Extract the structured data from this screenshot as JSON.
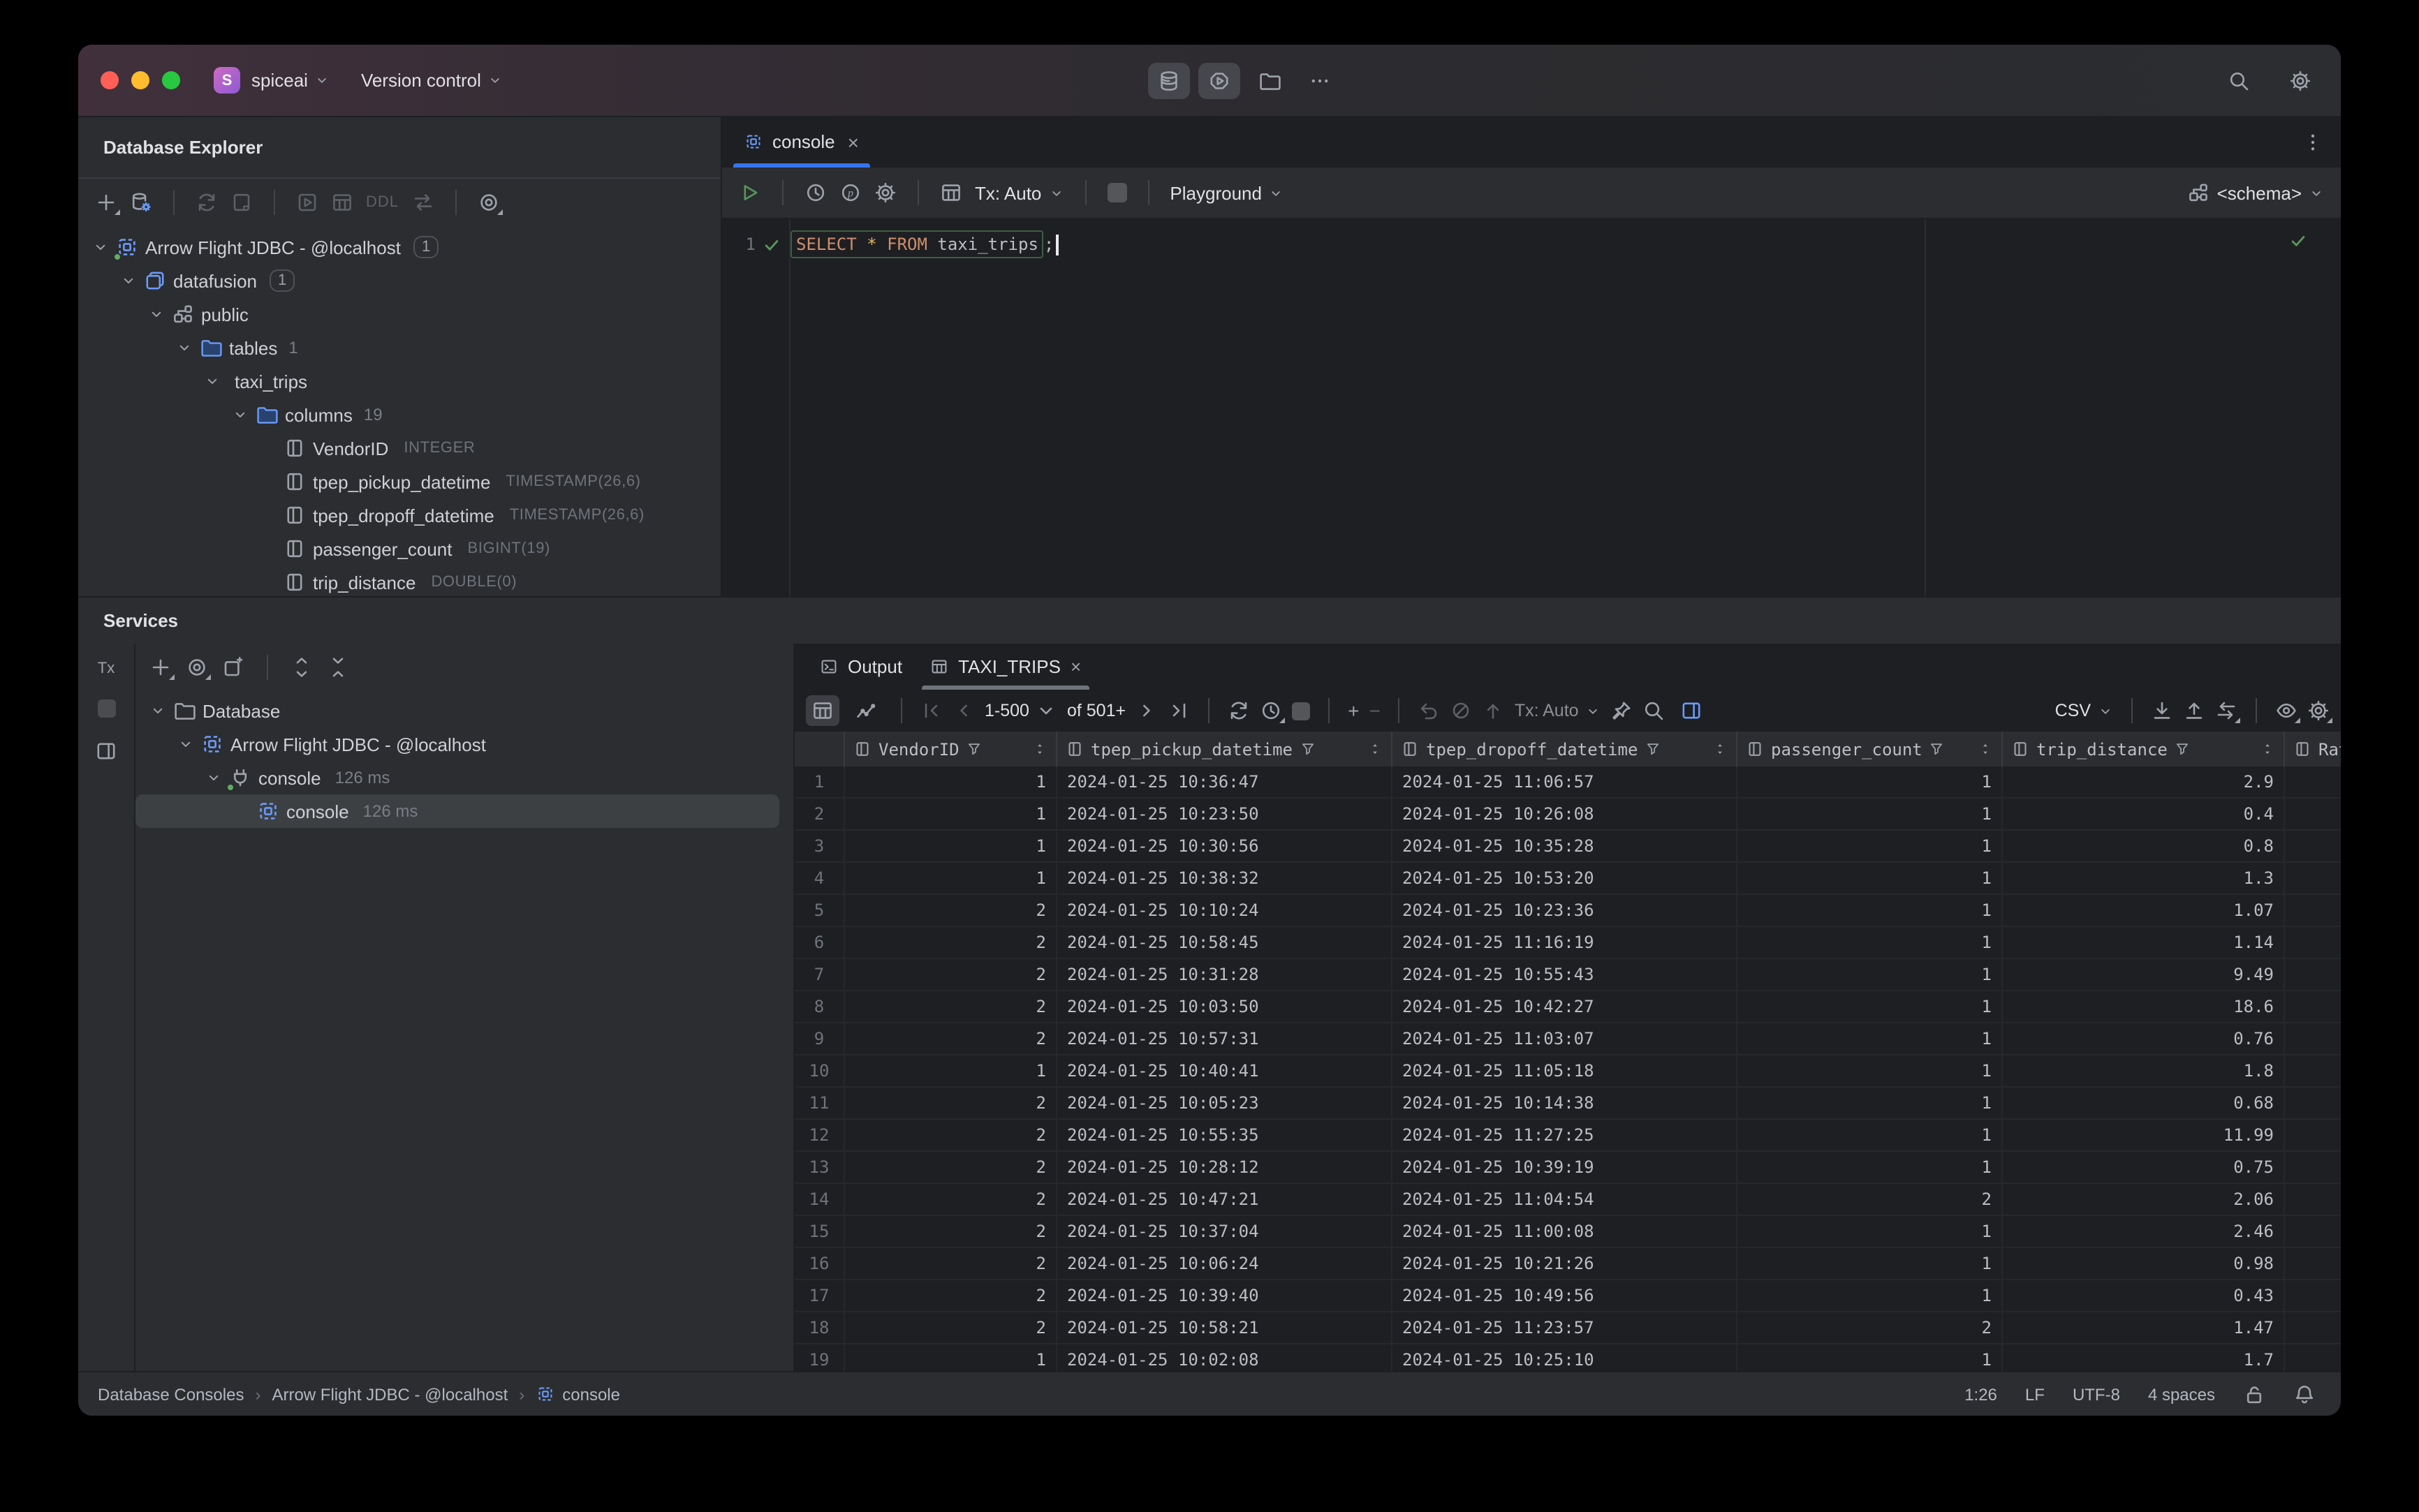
{
  "colors": {
    "accent_blue": "#3574f0",
    "icon_blue": "#6a9bfa",
    "green": "#57965c",
    "keyword_orange": "#cf8e6d",
    "star_yellow": "#e0b465",
    "window_bg": "#2b2d30",
    "editor_bg": "#1e1f22",
    "selection_bg": "#3d4043",
    "titlebar_tint": "#41303c"
  },
  "title_bar": {
    "app_badge": "S",
    "app_name": "spiceai",
    "menu_label": "Version control",
    "icons": [
      "database-icon",
      "hexagon-play-icon",
      "folder-icon",
      "more-icon",
      "search-icon",
      "settings-icon"
    ]
  },
  "database_explorer": {
    "title": "Database Explorer",
    "toolbar_icons": [
      "add-icon",
      "datasource-properties-icon",
      "refresh-icon",
      "jump-to-console-icon",
      "run-icon",
      "table-icon",
      "ddl-label",
      "compare-icon",
      "visibility-icon"
    ],
    "ddl_label": "DDL",
    "tree": [
      {
        "indent": 0,
        "icon": "datasource",
        "label": "Arrow Flight JDBC - @localhost",
        "badge": "1",
        "green_dot": true
      },
      {
        "indent": 1,
        "icon": "database",
        "label": "datafusion",
        "badge": "1"
      },
      {
        "indent": 2,
        "icon": "schema",
        "label": "public"
      },
      {
        "indent": 3,
        "icon": "folder",
        "label": "tables",
        "count": "1"
      },
      {
        "indent": 4,
        "icon": "table",
        "label": "taxi_trips"
      },
      {
        "indent": 5,
        "icon": "folder",
        "label": "columns",
        "count": "19"
      },
      {
        "indent": 6,
        "icon": "column",
        "label": "VendorID",
        "type": "INTEGER",
        "leaf": true
      },
      {
        "indent": 6,
        "icon": "column",
        "label": "tpep_pickup_datetime",
        "type": "TIMESTAMP(26,6)",
        "leaf": true
      },
      {
        "indent": 6,
        "icon": "column",
        "label": "tpep_dropoff_datetime",
        "type": "TIMESTAMP(26,6)",
        "leaf": true
      },
      {
        "indent": 6,
        "icon": "column",
        "label": "passenger_count",
        "type": "BIGINT(19)",
        "leaf": true
      },
      {
        "indent": 6,
        "icon": "column",
        "label": "trip_distance",
        "type": "DOUBLE(0)",
        "leaf": true
      }
    ]
  },
  "editor": {
    "tab_label": "console",
    "close_glyph": "×",
    "toolbar": {
      "tx_label": "Tx: Auto",
      "playground_label": "Playground",
      "schema_label": "<schema>"
    },
    "line_number": "1",
    "sql": {
      "keyword1": "SELECT",
      "star": "*",
      "keyword2": "FROM",
      "identifier": "taxi_trips",
      "semicolon": ";"
    }
  },
  "services": {
    "title": "Services",
    "side_tx_label": "Tx",
    "tree": [
      {
        "indent": 0,
        "icon": "folderOutline",
        "label": "Database"
      },
      {
        "indent": 1,
        "icon": "datasource",
        "label": "Arrow Flight JDBC - @localhost"
      },
      {
        "indent": 2,
        "icon": "plug",
        "label": "console",
        "time": "126 ms",
        "green_dot": true
      },
      {
        "indent": 3,
        "icon": "datasource",
        "label": "console",
        "time": "126 ms",
        "selected": true,
        "leaf": true
      }
    ]
  },
  "results": {
    "tabs": [
      {
        "label": "Output",
        "icon": "terminal"
      },
      {
        "label": "TAXI_TRIPS",
        "icon": "table",
        "active": true,
        "close_glyph": "×"
      }
    ],
    "toolbar": {
      "page_range": "1-500",
      "of_label": "of 501+",
      "tx_label": "Tx: Auto",
      "format_label": "CSV",
      "plus": "+",
      "minus": "−"
    },
    "table": {
      "columns": [
        {
          "name": "VendorID",
          "align": "right"
        },
        {
          "name": "tpep_pickup_datetime",
          "align": "left"
        },
        {
          "name": "tpep_dropoff_datetime",
          "align": "left"
        },
        {
          "name": "passenger_count",
          "align": "right"
        },
        {
          "name": "trip_distance",
          "align": "right"
        },
        {
          "name": "Rate",
          "align": "left"
        }
      ],
      "rows": [
        [
          "1",
          "2024-01-25 10:36:47",
          "2024-01-25 11:06:57",
          "1",
          "2.9"
        ],
        [
          "1",
          "2024-01-25 10:23:50",
          "2024-01-25 10:26:08",
          "1",
          "0.4"
        ],
        [
          "1",
          "2024-01-25 10:30:56",
          "2024-01-25 10:35:28",
          "1",
          "0.8"
        ],
        [
          "1",
          "2024-01-25 10:38:32",
          "2024-01-25 10:53:20",
          "1",
          "1.3"
        ],
        [
          "2",
          "2024-01-25 10:10:24",
          "2024-01-25 10:23:36",
          "1",
          "1.07"
        ],
        [
          "2",
          "2024-01-25 10:58:45",
          "2024-01-25 11:16:19",
          "1",
          "1.14"
        ],
        [
          "2",
          "2024-01-25 10:31:28",
          "2024-01-25 10:55:43",
          "1",
          "9.49"
        ],
        [
          "2",
          "2024-01-25 10:03:50",
          "2024-01-25 10:42:27",
          "1",
          "18.6"
        ],
        [
          "2",
          "2024-01-25 10:57:31",
          "2024-01-25 11:03:07",
          "1",
          "0.76"
        ],
        [
          "1",
          "2024-01-25 10:40:41",
          "2024-01-25 11:05:18",
          "1",
          "1.8"
        ],
        [
          "2",
          "2024-01-25 10:05:23",
          "2024-01-25 10:14:38",
          "1",
          "0.68"
        ],
        [
          "2",
          "2024-01-25 10:55:35",
          "2024-01-25 11:27:25",
          "1",
          "11.99"
        ],
        [
          "2",
          "2024-01-25 10:28:12",
          "2024-01-25 10:39:19",
          "1",
          "0.75"
        ],
        [
          "2",
          "2024-01-25 10:47:21",
          "2024-01-25 11:04:54",
          "2",
          "2.06"
        ],
        [
          "2",
          "2024-01-25 10:37:04",
          "2024-01-25 11:00:08",
          "1",
          "2.46"
        ],
        [
          "2",
          "2024-01-25 10:06:24",
          "2024-01-25 10:21:26",
          "1",
          "0.98"
        ],
        [
          "2",
          "2024-01-25 10:39:40",
          "2024-01-25 10:49:56",
          "1",
          "0.43"
        ],
        [
          "2",
          "2024-01-25 10:58:21",
          "2024-01-25 11:23:57",
          "2",
          "1.47"
        ],
        [
          "1",
          "2024-01-25 10:02:08",
          "2024-01-25 10:25:10",
          "1",
          "1.7"
        ]
      ]
    }
  },
  "status_bar": {
    "breadcrumbs": [
      {
        "label": "Database Consoles"
      },
      {
        "label": "Arrow Flight JDBC - @localhost"
      },
      {
        "label": "console",
        "icon": "datasource"
      }
    ],
    "caret_position": "1:26",
    "line_separator": "LF",
    "encoding": "UTF-8",
    "indent": "4 spaces"
  }
}
